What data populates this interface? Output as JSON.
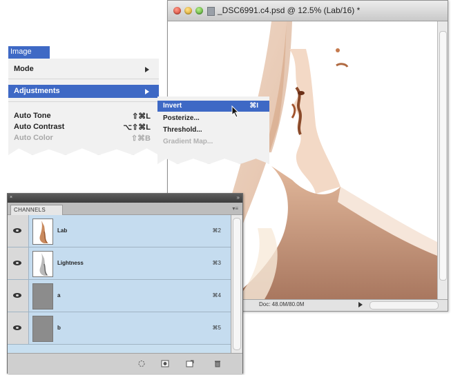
{
  "document": {
    "title": "_DSC6991.c4.psd @ 12.5% (Lab/16) *",
    "status": "Doc: 48.0M/80.0M"
  },
  "menu": {
    "image_label": "Image",
    "items": {
      "mode": "Mode",
      "adjustments": "Adjustments",
      "auto_tone": "Auto Tone",
      "auto_tone_sc": "⇧⌘L",
      "auto_contrast": "Auto Contrast",
      "auto_contrast_sc": "⌥⇧⌘L",
      "auto_color": "Auto Color",
      "auto_color_sc": "⇧⌘B"
    },
    "submenu": {
      "invert": "Invert",
      "invert_sc": "⌘I",
      "posterize": "Posterize...",
      "threshold": "Threshold...",
      "gradient_map": "Gradient Map..."
    }
  },
  "channels_panel": {
    "tab": "CHANNELS",
    "channels": [
      {
        "name": "Lab",
        "shortcut": "⌘2"
      },
      {
        "name": "Lightness",
        "shortcut": "⌘3"
      },
      {
        "name": "a",
        "shortcut": "⌘4"
      },
      {
        "name": "b",
        "shortcut": "⌘5"
      }
    ]
  },
  "colors": {
    "menu_highlight": "#3e69c5",
    "channel_row": "#c5dcef",
    "sepia": "#b5744a"
  }
}
